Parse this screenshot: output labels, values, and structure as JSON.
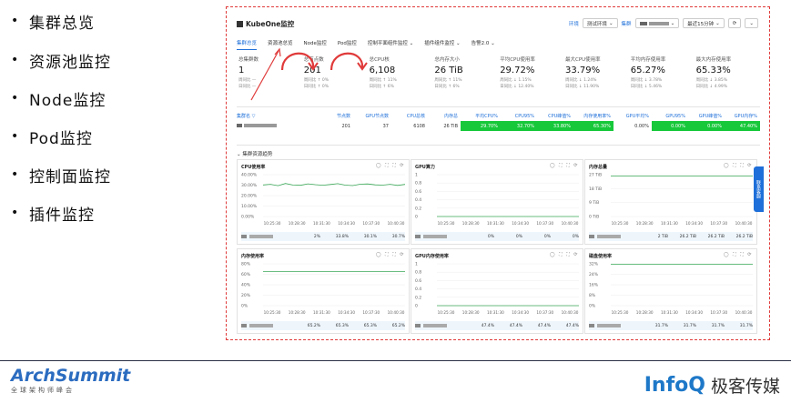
{
  "bullets": [
    "集群总览",
    "资源池监控",
    "Node监控",
    "Pod监控",
    "控制面监控",
    "插件监控"
  ],
  "app": {
    "title": "KubeOne监控",
    "env_label": "环境",
    "env_value": "测试环境",
    "cluster_label": "集群",
    "time_range": "最近15分钟",
    "refresh_icon": "refresh-icon"
  },
  "tabs": [
    {
      "label": "集群总览",
      "active": true
    },
    {
      "label": "资源池总览",
      "active": false
    },
    {
      "label": "Node监控",
      "active": false
    },
    {
      "label": "Pod监控",
      "active": false
    },
    {
      "label": "控制平面组件监控 ⌄",
      "active": false
    },
    {
      "label": "插件组件监控 ⌄",
      "active": false
    },
    {
      "label": "告警2.0 ⌄",
      "active": false
    }
  ],
  "stats": [
    {
      "label": "总集群数",
      "value": "1",
      "week": "周同比 —",
      "day": "日同比 —"
    },
    {
      "label": "总节点数",
      "value": "201",
      "week": "周同比 ↑ 0%",
      "day": "日同比 ↑ 0%"
    },
    {
      "label": "总CPU核",
      "value": "6,108",
      "week": "周同比 ↑ 11%",
      "day": "日同比 ↑ 6%"
    },
    {
      "label": "总内存大小",
      "value": "26 TiB",
      "week": "周同比 ↑ 11%",
      "day": "日同比 ↑ 6%"
    },
    {
      "label": "平均CPU使用率",
      "value": "29.72%",
      "week": "周同比 ↓ 1.15%",
      "day": "日同比 ↓ 12.40%"
    },
    {
      "label": "最大CPU使用率",
      "value": "33.79%",
      "week": "周同比 ↓ 1.24%",
      "day": "日同比 ↓ 11.90%"
    },
    {
      "label": "平均内存使用率",
      "value": "65.27%",
      "week": "周同比 ↓ 3.78%",
      "day": "日同比 ↓ 5.46%"
    },
    {
      "label": "最大内存使用率",
      "value": "65.33%",
      "week": "周同比 ↓ 3.85%",
      "day": "日同比 ↓ 4.99%"
    }
  ],
  "table": {
    "headers": [
      "集群名 ▽",
      "节点数",
      "GPU节点数",
      "CPU总核",
      "内存总",
      "平均CPU%",
      "CPU95%",
      "CPU峰值%",
      "内存使用率%",
      "GPU平均%",
      "GPU95%",
      "GPU峰值%",
      "GPU内存%"
    ],
    "row": [
      "",
      "201",
      "37",
      "6108",
      "26 TiB",
      "29.70%",
      "32.70%",
      "33.80%",
      "65.30%",
      "0.00%",
      "0.00%",
      "0.00%",
      "47.40%"
    ],
    "green_cols": [
      5,
      6,
      7,
      8,
      10,
      11,
      12
    ]
  },
  "section_title": "集群资源趋势",
  "panel_icons": "◯ ⛶ ⛶ ⟳",
  "panels": [
    {
      "title": "CPU使用率",
      "yticks": [
        "40.00%",
        "30.00%",
        "20.00%",
        "10.00%",
        "0.00%"
      ],
      "xticks": [
        "10:25:30",
        "10:28:30",
        "10:31:30",
        "10:34:30",
        "10:37:30",
        "10:40:30"
      ],
      "footer": [
        "2%",
        "33.8%",
        "30.1%",
        "30.7%"
      ],
      "series": [
        30.2,
        30.8,
        29.5,
        31.6,
        30.1,
        29.8,
        31.2,
        30.4,
        29.9,
        30.6,
        31.4,
        30.0,
        29.6,
        30.9,
        31.1,
        30.3,
        30.0,
        30.8,
        29.7,
        30.7
      ]
    },
    {
      "title": "GPU算力",
      "yticks": [
        "1",
        "0.8",
        "0.6",
        "0.4",
        "0.2",
        "0"
      ],
      "xticks": [
        "10:25:30",
        "10:28:30",
        "10:31:30",
        "10:34:30",
        "10:37:30",
        "10:40:30"
      ],
      "footer": [
        "0%",
        "0%",
        "0%",
        "0%"
      ],
      "series": [
        0,
        0,
        0,
        0,
        0,
        0,
        0,
        0,
        0,
        0,
        0,
        0,
        0,
        0,
        0,
        0,
        0,
        0,
        0,
        0
      ]
    },
    {
      "title": "内存总量",
      "yticks": [
        "27 TiB",
        "18 TiB",
        "9 TiB",
        "0 TiB"
      ],
      "xticks": [
        "10:25:30",
        "10:28:30",
        "10:31:30",
        "10:34:30",
        "10:37:30",
        "10:40:30"
      ],
      "footer": [
        "2 TiB",
        "26.2 TiB",
        "26.2 TiB",
        "26.2 TiB"
      ],
      "series": [
        26.2,
        26.2,
        26.2,
        26.2,
        26.2,
        26.2,
        26.2,
        26.2,
        26.2,
        26.2,
        26.2,
        26.2,
        26.2,
        26.2,
        26.2,
        26.2,
        26.2,
        26.2,
        26.2,
        26.2
      ]
    },
    {
      "title": "内存使用率",
      "yticks": [
        "80%",
        "60%",
        "40%",
        "20%",
        "0%"
      ],
      "xticks": [
        "10:25:30",
        "10:28:30",
        "10:31:30",
        "10:34:30",
        "10:37:30",
        "10:40:30"
      ],
      "footer": [
        "65.2%",
        "65.3%",
        "65.3%",
        "65.2%"
      ],
      "series": [
        65.2,
        65.3,
        65.2,
        65.3,
        65.2,
        65.3,
        65.2,
        65.3,
        65.2,
        65.3,
        65.2,
        65.3,
        65.2,
        65.3,
        65.2,
        65.3,
        65.2,
        65.3,
        65.2,
        65.2
      ]
    },
    {
      "title": "GPU内存使用率",
      "yticks": [
        "1",
        "0.8",
        "0.6",
        "0.4",
        "0.2",
        "0"
      ],
      "xticks": [
        "10:25:30",
        "10:28:30",
        "10:31:30",
        "10:34:30",
        "10:37:30",
        "10:40:30"
      ],
      "footer": [
        "47.4%",
        "47.4%",
        "47.4%",
        "47.4%"
      ],
      "series": [
        0,
        0,
        0,
        0,
        0,
        0,
        0,
        0,
        0,
        0,
        0,
        0,
        0,
        0,
        0,
        0,
        0,
        0,
        0,
        0
      ]
    },
    {
      "title": "磁盘使用率",
      "yticks": [
        "32%",
        "24%",
        "16%",
        "8%",
        "0%"
      ],
      "xticks": [
        "10:25:30",
        "10:28:30",
        "10:31:30",
        "10:34:30",
        "10:37:30",
        "10:40:30"
      ],
      "footer": [
        "31.7%",
        "31.7%",
        "31.7%",
        "31.7%"
      ],
      "series": [
        31.7,
        31.7,
        31.7,
        31.7,
        31.7,
        31.7,
        31.7,
        31.7,
        31.7,
        31.7,
        31.7,
        31.7,
        31.7,
        31.7,
        31.7,
        31.7,
        31.7,
        31.7,
        31.7,
        31.7
      ]
    }
  ],
  "side_tab": "联系客服",
  "branding": {
    "left": "ArchSummit",
    "left_sub": "全球架构师峰会",
    "right_en": "InfoQ",
    "right_cn": "极客传媒"
  },
  "colors": {
    "accent": "#1e6fd9",
    "positive": "#17c83a",
    "alert": "#e03a3a",
    "line": "#3aa857"
  }
}
